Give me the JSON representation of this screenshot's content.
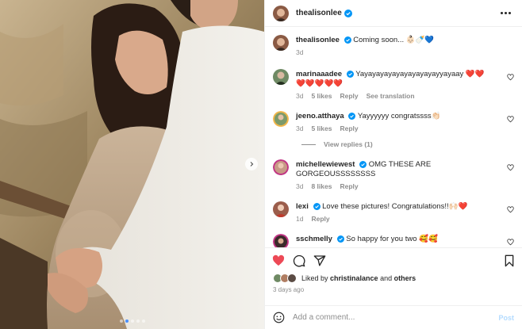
{
  "post": {
    "author": "thealisonlee",
    "caption_user": "thealisonlee",
    "caption_text": "Coming soon... 👶🏻🍼💙",
    "caption_age": "3d",
    "carousel": {
      "slides": 5,
      "active_index": 1
    }
  },
  "comments": [
    {
      "user": "marinaaadee",
      "verified": true,
      "text": "Yayayayayayayayayayayyayaay ❤️❤️❤️❤️❤️❤️❤️",
      "age": "3d",
      "likes": "5 likes",
      "reply": "Reply",
      "translate": "See translation"
    },
    {
      "user": "jeeno.atthaya",
      "verified": true,
      "text": "Yayyyyyy congratssss👏🏻",
      "age": "3d",
      "likes": "5 likes",
      "reply": "Reply",
      "view_replies": "View replies (1)"
    },
    {
      "user": "michellewiewest",
      "verified": true,
      "text": "OMG THESE ARE GORGEOUSSSSSSSS",
      "age": "3d",
      "likes": "8 likes",
      "reply": "Reply"
    },
    {
      "user": "lexi",
      "verified": true,
      "text": "Love these pictures! Congratulations!!🙌🏻❤️",
      "age": "1d",
      "likes": "",
      "reply": "Reply"
    },
    {
      "user": "sschmelly",
      "verified": true,
      "text": "So happy for you two 🥰🥰",
      "age": "",
      "likes": "",
      "reply": ""
    }
  ],
  "likes_line": {
    "prefix": "Liked by ",
    "user": "christinalance",
    "mid": " and ",
    "others": "others"
  },
  "timestamp": "3 days ago",
  "composer": {
    "placeholder": "Add a comment...",
    "post_label": "Post"
  },
  "icons": {
    "more": "more-options-icon",
    "verified": "verified-badge-icon",
    "like": "heart-filled-icon",
    "comment": "comment-icon",
    "share": "share-icon",
    "save": "bookmark-icon",
    "emoji": "emoji-icon",
    "next": "chevron-right-icon"
  },
  "colors": {
    "like_red": "#ed4956",
    "verified_blue": "#0095f6",
    "link_gray": "#8e8e8e",
    "post_disabled": "#b3dbff"
  }
}
